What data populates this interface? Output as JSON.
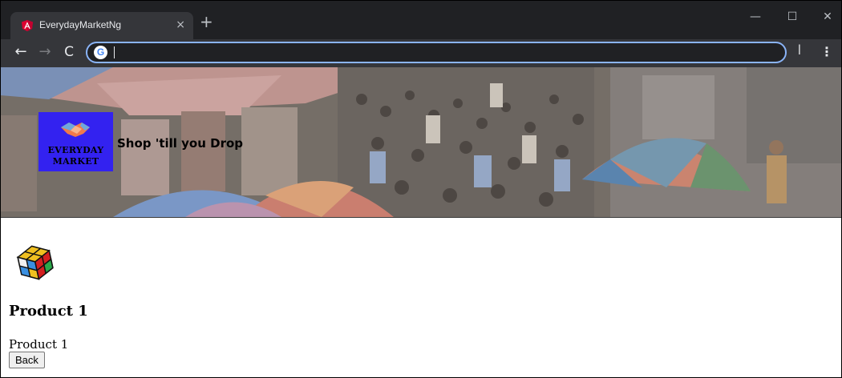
{
  "browser": {
    "tab_title": "EverydayMarketNg",
    "tab_close": "×",
    "new_tab": "+",
    "window_minimize": "—",
    "window_maximize": "☐",
    "window_close": "✕",
    "nav_back": "←",
    "nav_forward": "→",
    "nav_reload": "C",
    "omnibox_value": "",
    "google_icon": "G",
    "extension_icon": "ꟾ",
    "menu_icon": "⋮"
  },
  "header": {
    "logo_line1": "EVERYDAY",
    "logo_line2": "MARKET",
    "tagline": "Shop 'till you Drop",
    "hero_image": "market-crowd-photo"
  },
  "product": {
    "image": "rubiks-cube-icon",
    "title": "Product 1",
    "description": "Product 1",
    "back_label": "Back"
  },
  "colors": {
    "chrome_dark": "#202124",
    "chrome_toolbar": "#35363a",
    "omnibox_focus": "#8ab4f8",
    "logo_background": "#3322f0",
    "angular_red": "#dd0031"
  }
}
